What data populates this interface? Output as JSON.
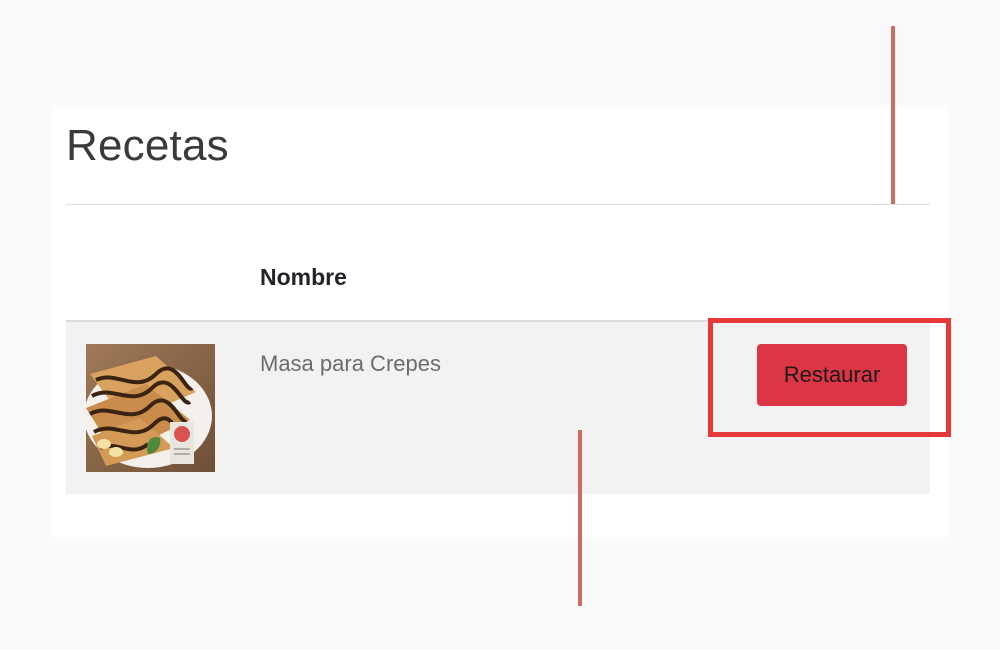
{
  "page": {
    "title": "Recetas"
  },
  "table": {
    "columns": [
      "Nombre"
    ],
    "rows": [
      {
        "thumbnail_icon": "crepe-recipe-thumbnail",
        "name": "Masa para Crepes",
        "action_label": "Restaurar"
      }
    ]
  },
  "colors": {
    "button": "#dc3545",
    "row_background": "#f2f2f2",
    "highlight_border": "#e8393a",
    "guide_line": "#cf6b63"
  }
}
